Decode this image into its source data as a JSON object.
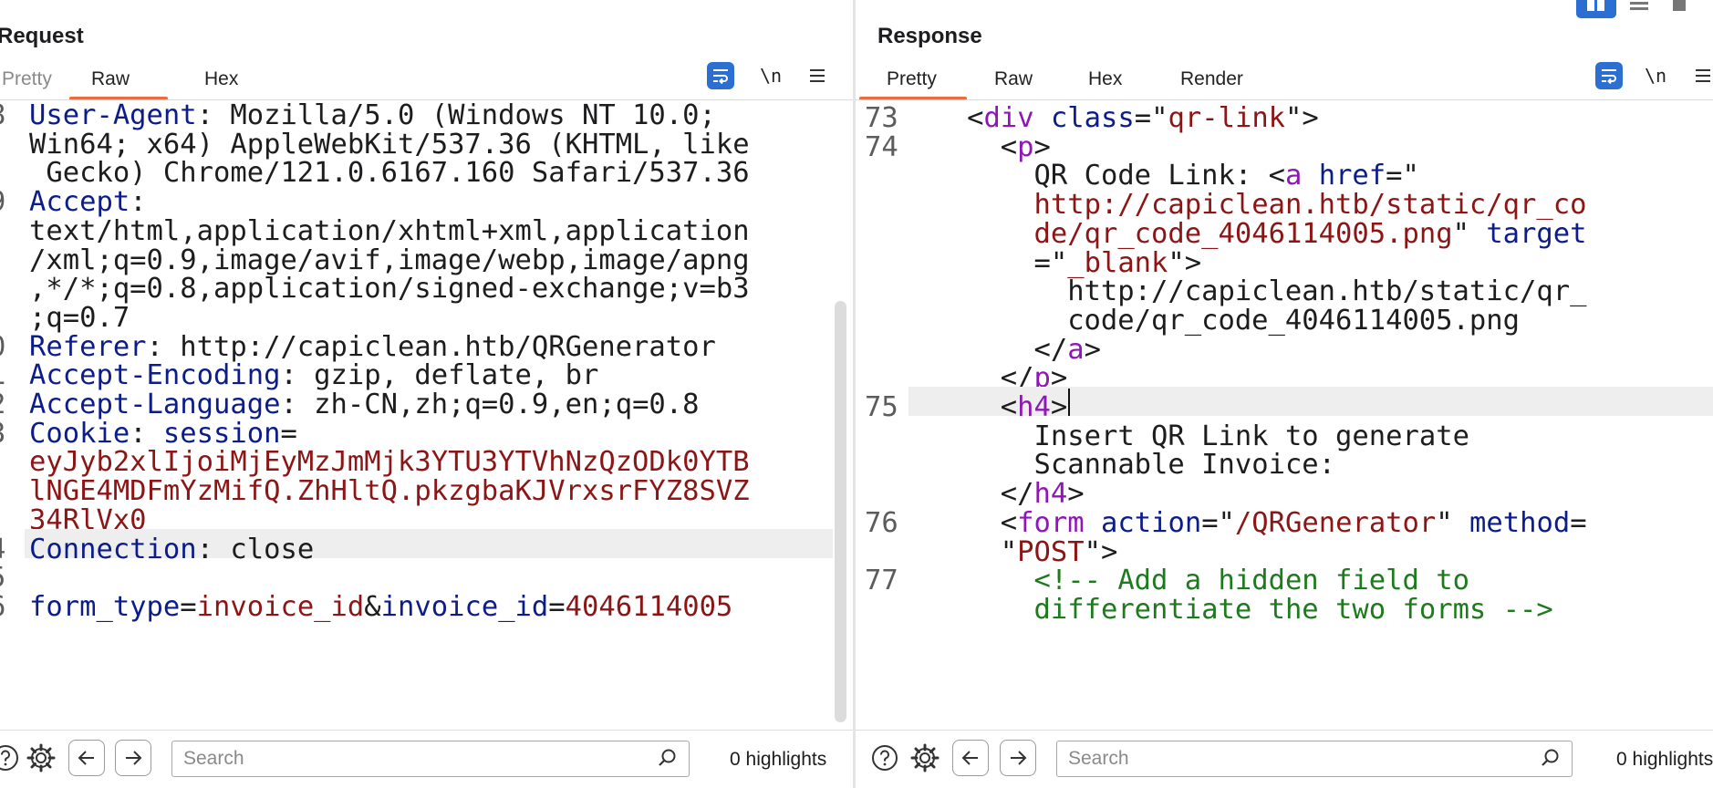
{
  "request": {
    "title": "Request",
    "tabs": [
      "Pretty",
      "Raw",
      "Hex"
    ],
    "active_tab": "Raw",
    "toolbar": {
      "wrap_icon": "wrap-lines-icon",
      "newline_label": "\\n",
      "menu_icon": "menu-icon"
    },
    "lines": [
      {
        "num": "8",
        "segments": [
          {
            "t": "User-Agent",
            "c": "k"
          },
          {
            "t": ": Mozilla/5.0 (Windows NT 10.0;",
            "c": "p"
          }
        ]
      },
      {
        "num": "",
        "segments": [
          {
            "t": "Win64; x64) AppleWebKit/537.36 (KHTML, like",
            "c": "p"
          }
        ]
      },
      {
        "num": "",
        "segments": [
          {
            "t": " Gecko) Chrome/121.0.6167.160 Safari/537.36",
            "c": "p"
          }
        ]
      },
      {
        "num": "9",
        "segments": [
          {
            "t": "Accept",
            "c": "k"
          },
          {
            "t": ":",
            "c": "p"
          }
        ]
      },
      {
        "num": "",
        "segments": [
          {
            "t": "text/html,application/xhtml+xml,application",
            "c": "p"
          }
        ]
      },
      {
        "num": "",
        "segments": [
          {
            "t": "/xml;q=0.9,image/avif,image/webp,image/apng",
            "c": "p"
          }
        ]
      },
      {
        "num": "",
        "segments": [
          {
            "t": ",*/*;q=0.8,application/signed-exchange;v=b3",
            "c": "p"
          }
        ]
      },
      {
        "num": "",
        "segments": [
          {
            "t": ";q=0.7",
            "c": "p"
          }
        ]
      },
      {
        "num": "0",
        "segments": [
          {
            "t": "Referer",
            "c": "k"
          },
          {
            "t": ": http://capiclean.htb/QRGenerator",
            "c": "p"
          }
        ]
      },
      {
        "num": "1",
        "segments": [
          {
            "t": "Accept-Encoding",
            "c": "k"
          },
          {
            "t": ": gzip, deflate, br",
            "c": "p"
          }
        ]
      },
      {
        "num": "2",
        "segments": [
          {
            "t": "Accept-Language",
            "c": "k"
          },
          {
            "t": ": zh-CN,zh;q=0.9,en;q=0.8",
            "c": "p"
          }
        ]
      },
      {
        "num": "3",
        "segments": [
          {
            "t": "Cookie",
            "c": "k"
          },
          {
            "t": ": ",
            "c": "p"
          },
          {
            "t": "session",
            "c": "k"
          },
          {
            "t": "=",
            "c": "p"
          }
        ]
      },
      {
        "num": "",
        "segments": [
          {
            "t": "eyJyb2xlIjoiMjEyMzJmMjk3YTU3YTVhNzQzODk0YTB",
            "c": "v"
          }
        ]
      },
      {
        "num": "",
        "segments": [
          {
            "t": "lNGE4MDFmYzMifQ.ZhHltQ.pkzgbaKJVrxsrFYZ8SVZ",
            "c": "v"
          }
        ]
      },
      {
        "num": "",
        "segments": [
          {
            "t": "34RlVx0",
            "c": "v"
          }
        ]
      },
      {
        "num": "4",
        "segments": [
          {
            "t": "Connection",
            "c": "k"
          },
          {
            "t": ": close",
            "c": "p"
          }
        ]
      },
      {
        "num": "5",
        "segments": []
      },
      {
        "num": "6",
        "segments": [
          {
            "t": "form_type",
            "c": "k"
          },
          {
            "t": "=",
            "c": "p"
          },
          {
            "t": "invoice_id",
            "c": "v"
          },
          {
            "t": "&",
            "c": "p"
          },
          {
            "t": "invoice_id",
            "c": "k"
          },
          {
            "t": "=",
            "c": "p"
          },
          {
            "t": "4046114005",
            "c": "v"
          }
        ]
      }
    ],
    "highlighted_line_index": 15,
    "footer": {
      "help_icon": "help-icon",
      "settings_icon": "gear-icon",
      "back_icon": "arrow-left-icon",
      "forward_icon": "arrow-right-icon",
      "search_placeholder": "Search",
      "highlights": "0 highlights"
    }
  },
  "response": {
    "title": "Response",
    "tabs": [
      "Pretty",
      "Raw",
      "Hex",
      "Render"
    ],
    "active_tab": "Pretty",
    "toolbar": {
      "wrap_icon": "wrap-lines-icon",
      "newline_label": "\\n",
      "menu_icon": "menu-icon"
    },
    "lines": [
      {
        "num": "73",
        "indent": 6,
        "segments": [
          {
            "t": "<",
            "c": "p"
          },
          {
            "t": "div",
            "c": "tg"
          },
          {
            "t": " ",
            "c": "p"
          },
          {
            "t": "class",
            "c": "at"
          },
          {
            "t": "=\"",
            "c": "p"
          },
          {
            "t": "qr-link",
            "c": "vr"
          },
          {
            "t": "\">",
            "c": "p"
          }
        ]
      },
      {
        "num": "74",
        "indent": 8,
        "segments": [
          {
            "t": "<",
            "c": "p"
          },
          {
            "t": "p",
            "c": "tg"
          },
          {
            "t": ">",
            "c": "p"
          }
        ]
      },
      {
        "num": "",
        "indent": 10,
        "segments": [
          {
            "t": "QR Code Link: <",
            "c": "p"
          },
          {
            "t": "a",
            "c": "tg"
          },
          {
            "t": " ",
            "c": "p"
          },
          {
            "t": "href",
            "c": "at"
          },
          {
            "t": "=\"",
            "c": "p"
          }
        ]
      },
      {
        "num": "",
        "indent": 10,
        "segments": [
          {
            "t": "http://capiclean.htb/static/qr_co",
            "c": "vr"
          }
        ]
      },
      {
        "num": "",
        "indent": 10,
        "segments": [
          {
            "t": "de/qr_code_4046114005.png",
            "c": "vr"
          },
          {
            "t": "\" ",
            "c": "p"
          },
          {
            "t": "target",
            "c": "at"
          }
        ]
      },
      {
        "num": "",
        "indent": 10,
        "segments": [
          {
            "t": "=\"",
            "c": "p"
          },
          {
            "t": "_blank",
            "c": "vr"
          },
          {
            "t": "\">",
            "c": "p"
          }
        ]
      },
      {
        "num": "",
        "indent": 12,
        "segments": [
          {
            "t": "http://capiclean.htb/static/qr_",
            "c": "p"
          }
        ]
      },
      {
        "num": "",
        "indent": 12,
        "segments": [
          {
            "t": "code/qr_code_4046114005.png",
            "c": "p"
          }
        ]
      },
      {
        "num": "",
        "indent": 10,
        "segments": [
          {
            "t": "</",
            "c": "p"
          },
          {
            "t": "a",
            "c": "tg"
          },
          {
            "t": ">",
            "c": "p"
          }
        ]
      },
      {
        "num": "",
        "indent": 8,
        "segments": [
          {
            "t": "</",
            "c": "p"
          },
          {
            "t": "p",
            "c": "tg"
          },
          {
            "t": ">",
            "c": "p"
          }
        ]
      },
      {
        "num": "75",
        "indent": 8,
        "segments": [
          {
            "t": "<",
            "c": "p"
          },
          {
            "t": "h4",
            "c": "tg"
          },
          {
            "t": ">",
            "c": "p"
          }
        ]
      },
      {
        "num": "",
        "indent": 10,
        "segments": [
          {
            "t": "Insert QR Link to generate",
            "c": "p"
          }
        ]
      },
      {
        "num": "",
        "indent": 10,
        "segments": [
          {
            "t": "Scannable Invoice:",
            "c": "p"
          }
        ]
      },
      {
        "num": "",
        "indent": 8,
        "segments": [
          {
            "t": "</",
            "c": "p"
          },
          {
            "t": "h4",
            "c": "tg"
          },
          {
            "t": ">",
            "c": "p"
          }
        ]
      },
      {
        "num": "76",
        "indent": 8,
        "segments": [
          {
            "t": "<",
            "c": "p"
          },
          {
            "t": "form",
            "c": "tg"
          },
          {
            "t": " ",
            "c": "p"
          },
          {
            "t": "action",
            "c": "at"
          },
          {
            "t": "=\"",
            "c": "p"
          },
          {
            "t": "/QRGenerator",
            "c": "vr"
          },
          {
            "t": "\" ",
            "c": "p"
          },
          {
            "t": "method",
            "c": "at"
          },
          {
            "t": "=",
            "c": "p"
          }
        ]
      },
      {
        "num": "",
        "indent": 8,
        "segments": [
          {
            "t": "\"",
            "c": "p"
          },
          {
            "t": "POST",
            "c": "vr"
          },
          {
            "t": "\">",
            "c": "p"
          }
        ]
      },
      {
        "num": "77",
        "indent": 10,
        "segments": [
          {
            "t": "<!-- Add a hidden field to",
            "c": "cm"
          }
        ]
      },
      {
        "num": "",
        "indent": 10,
        "segments": [
          {
            "t": "differentiate the two forms -->",
            "c": "cm"
          }
        ]
      }
    ],
    "highlighted_line_index": 10,
    "footer": {
      "help_icon": "help-icon",
      "settings_icon": "gear-icon",
      "back_icon": "arrow-left-icon",
      "forward_icon": "arrow-right-icon",
      "search_placeholder": "Search",
      "highlights": "0 highlights"
    }
  },
  "layout_mode": {
    "icons": [
      "split-horizontal-icon",
      "split-vertical-icon",
      "tabs-layout-icon"
    ]
  },
  "colors": {
    "accent": "#2b6fd3",
    "tab_underline": "#ec6b3f",
    "key": "#0c1d8a",
    "value": "#8c1616",
    "tag": "#8e17b5",
    "comment": "#1d7a1d"
  }
}
